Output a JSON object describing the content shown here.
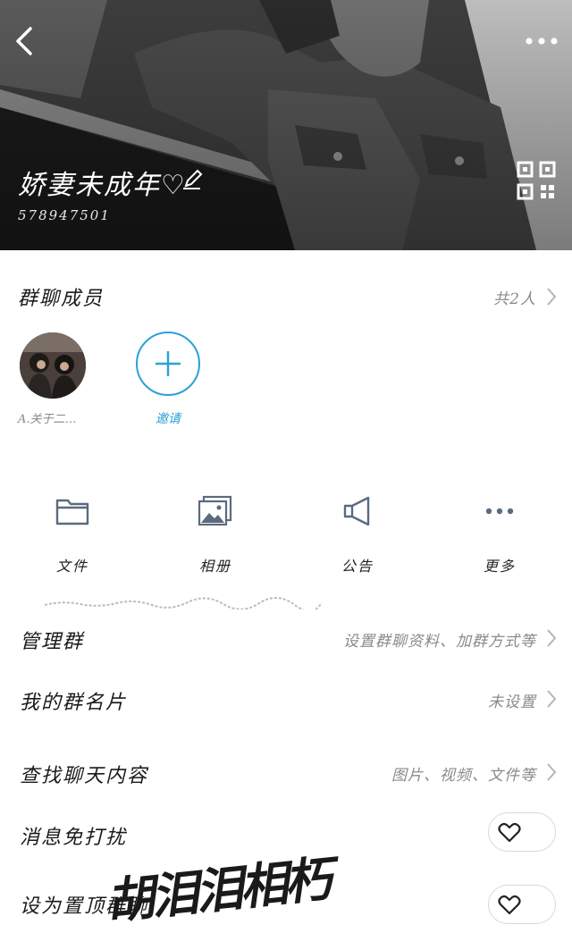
{
  "header": {
    "group_name": "娇妻未成年♡",
    "group_id": "578947501"
  },
  "members": {
    "title": "群聊成员",
    "count_label": "共2人",
    "items": [
      {
        "name": "A.关于二…"
      }
    ],
    "invite_label": "邀请"
  },
  "actions": [
    {
      "label": "文件",
      "icon": "folder-icon"
    },
    {
      "label": "相册",
      "icon": "photo-album-icon"
    },
    {
      "label": "公告",
      "icon": "megaphone-icon"
    },
    {
      "label": "更多",
      "icon": "more-dots-icon"
    }
  ],
  "settings": {
    "manage": {
      "title": "管理群",
      "value": "设置群聊资料、加群方式等"
    },
    "card": {
      "title": "我的群名片",
      "value": "未设置"
    },
    "search": {
      "title": "查找聊天内容",
      "value": "图片、视频、文件等"
    },
    "mute": {
      "title": "消息免打扰"
    },
    "pin": {
      "title": "设为置顶群聊"
    }
  },
  "watermark_text": "胡泪泪相朽",
  "colors": {
    "accent": "#2aa1d8",
    "header_bg": "#2a2a2a",
    "text_primary": "#1a1a1a",
    "text_secondary": "#8a8a8a"
  }
}
